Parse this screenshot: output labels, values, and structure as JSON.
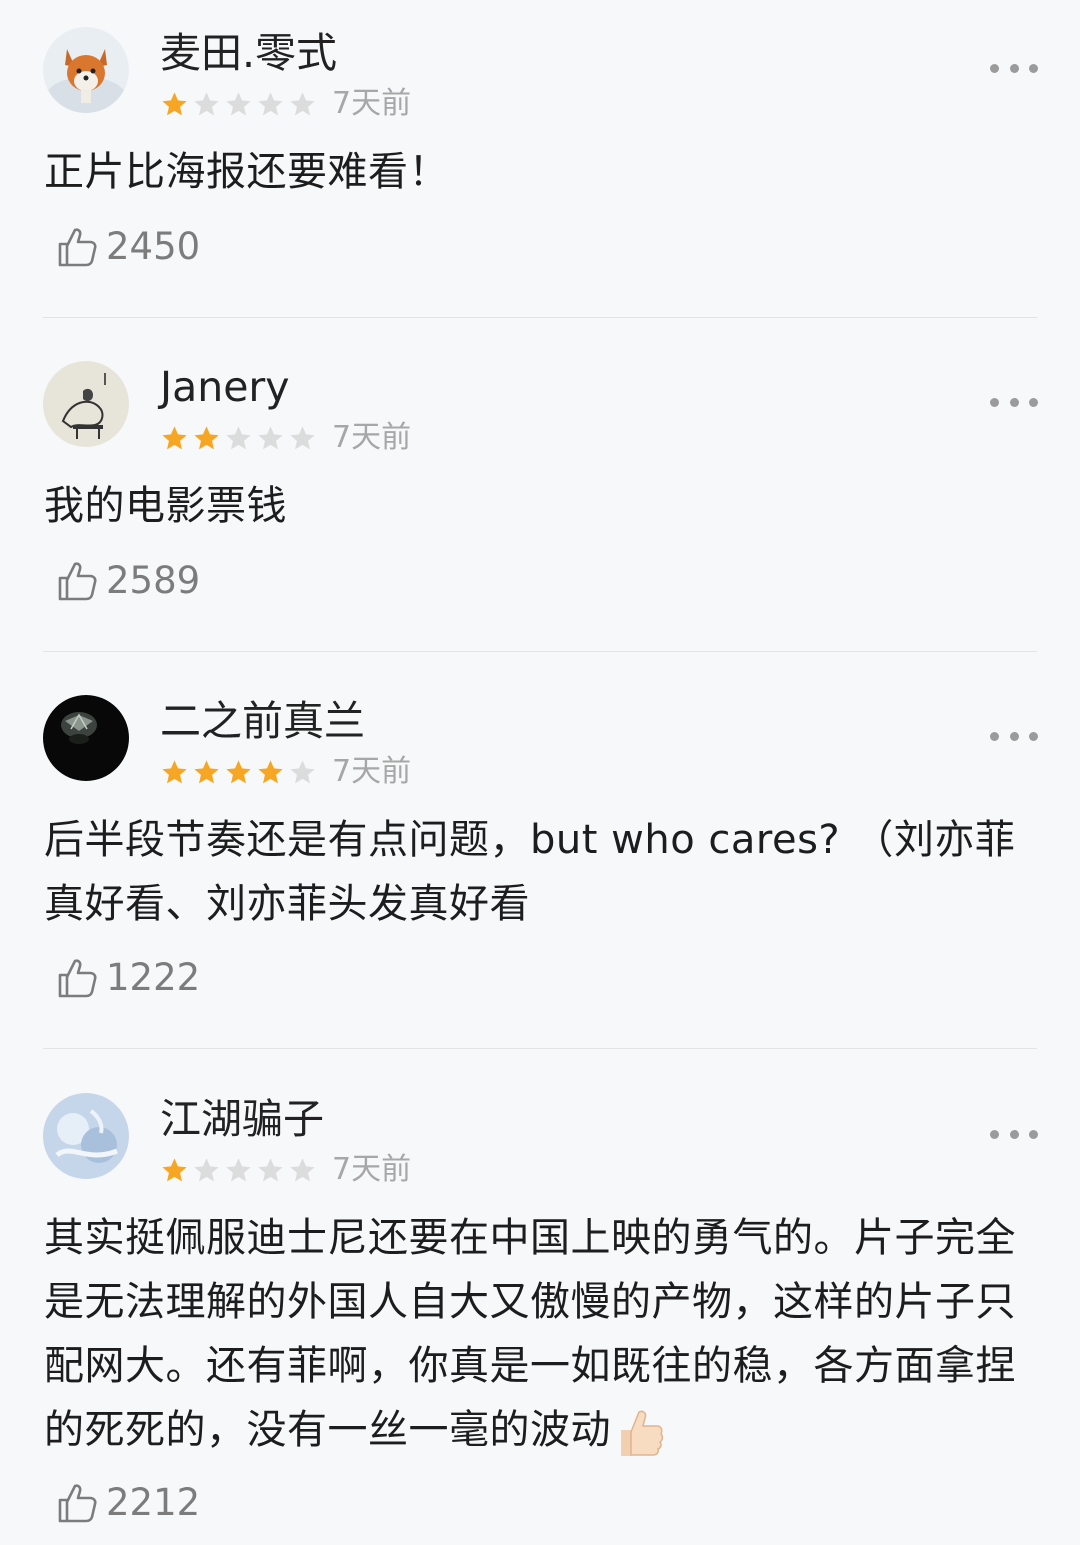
{
  "colors": {
    "star_filled": "#f6a623",
    "star_empty": "#dcdcdc",
    "text": "#1d1d1d",
    "muted": "#a7a7a7"
  },
  "icons": {
    "more": "more-dots-icon",
    "like": "thumbs-up-outline-icon",
    "star": "star-icon"
  },
  "reviews": [
    {
      "user": "麦田.零式",
      "rating": 1,
      "max_rating": 5,
      "time": "7天前",
      "text": "正片比海报还要难看！",
      "likes": "2450"
    },
    {
      "user": "Janery",
      "rating": 2,
      "max_rating": 5,
      "time": "7天前",
      "text": "我的电影票钱",
      "likes": "2589"
    },
    {
      "user": "二之前真兰",
      "rating": 4,
      "max_rating": 5,
      "time": "7天前",
      "text": "后半段节奏还是有点问题，but who cares? （刘亦菲真好看、刘亦菲头发真好看",
      "likes": "1222"
    },
    {
      "user": "江湖骗子",
      "rating": 1,
      "max_rating": 5,
      "time": "7天前",
      "text": "其实挺佩服迪士尼还要在中国上映的勇气的。片子完全是无法理解的外国人自大又傲慢的产物，这样的片子只配网大。还有菲啊，你真是一如既往的稳，各方面拿捏的死死的，没有一丝一毫的波动",
      "likes": "2212"
    }
  ]
}
